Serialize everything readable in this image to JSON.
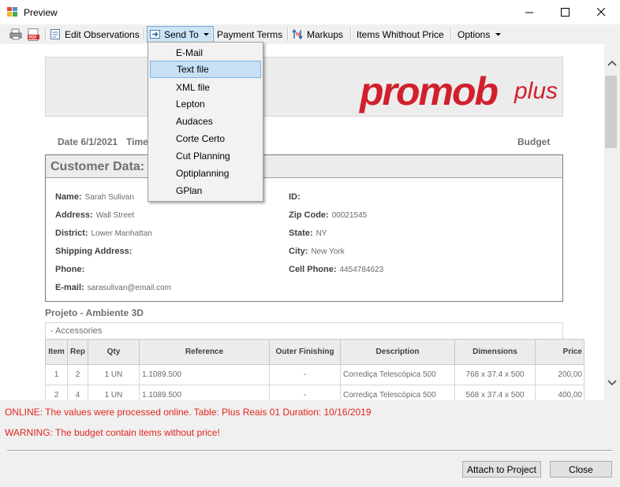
{
  "window": {
    "title": "Preview",
    "minimize": "—",
    "maximize": "☐",
    "close": "✕"
  },
  "toolbar": {
    "edit_observations": "Edit Observations",
    "send_to": "Send To",
    "payment_terms": "Payment Terms",
    "markups": "Markups",
    "items_without_price": "Items Whithout Price",
    "options": "Options"
  },
  "send_to_menu": {
    "items": [
      "E-Mail",
      "Text file",
      "XML file",
      "Lepton",
      "Audaces",
      "Corte Certo",
      "Cut Planning",
      "Optiplanning",
      "GPlan"
    ],
    "selected": "Text file"
  },
  "document": {
    "logo_main": "promob",
    "logo_sub": "plus",
    "date": "Date 6/1/2021",
    "time_label": "Time",
    "budget_label": "Budget",
    "customer_title": "Customer Data:",
    "customer": {
      "name_label": "Name:",
      "name": "Sarah Sulivan",
      "address_label": "Address:",
      "address": "Wall Street",
      "district_label": "District:",
      "district": "Lower Manhattan",
      "shipping_label": "Shipping Address:",
      "shipping": "",
      "phone_label": "Phone:",
      "phone": "",
      "email_label": "E-mail:",
      "email": "sarasulivan@email.com",
      "id_label": "ID:",
      "id": "",
      "zip_label": "Zip Code:",
      "zip": "00021545",
      "state_label": "State:",
      "state": "NY",
      "city_label": "City:",
      "city": "New York",
      "cell_label": "Cell Phone:",
      "cell": "4454784623"
    },
    "project_title": "Projeto - Ambiente 3D",
    "accessories_label": "- Accessories",
    "table": {
      "headers": [
        "Item",
        "Rep",
        "Qty",
        "Reference",
        "Outer Finishing",
        "Description",
        "Dimensions",
        "Price"
      ],
      "rows": [
        [
          "1",
          "2",
          "1 UN",
          "1.1089.500",
          "-",
          "Corrediça Telescópica 500",
          "768 x 37.4 x 500",
          "200,00"
        ],
        [
          "2",
          "4",
          "1 UN",
          "1.1089.500",
          "-",
          "Corrediça Telescópica 500",
          "568 x 37.4 x 500",
          "400,00"
        ]
      ]
    }
  },
  "status": {
    "online": "ONLINE: The values were processed online. Table: Plus Reais 01 Duration: 10/16/2019",
    "warning": "WARNING: The budget contain items without price!"
  },
  "buttons": {
    "attach": "Attach to Project",
    "close": "Close"
  },
  "colors": {
    "status_text": "#e1251b",
    "logo": "#d11f2c",
    "menu_highlight": "#c6e0f6"
  }
}
